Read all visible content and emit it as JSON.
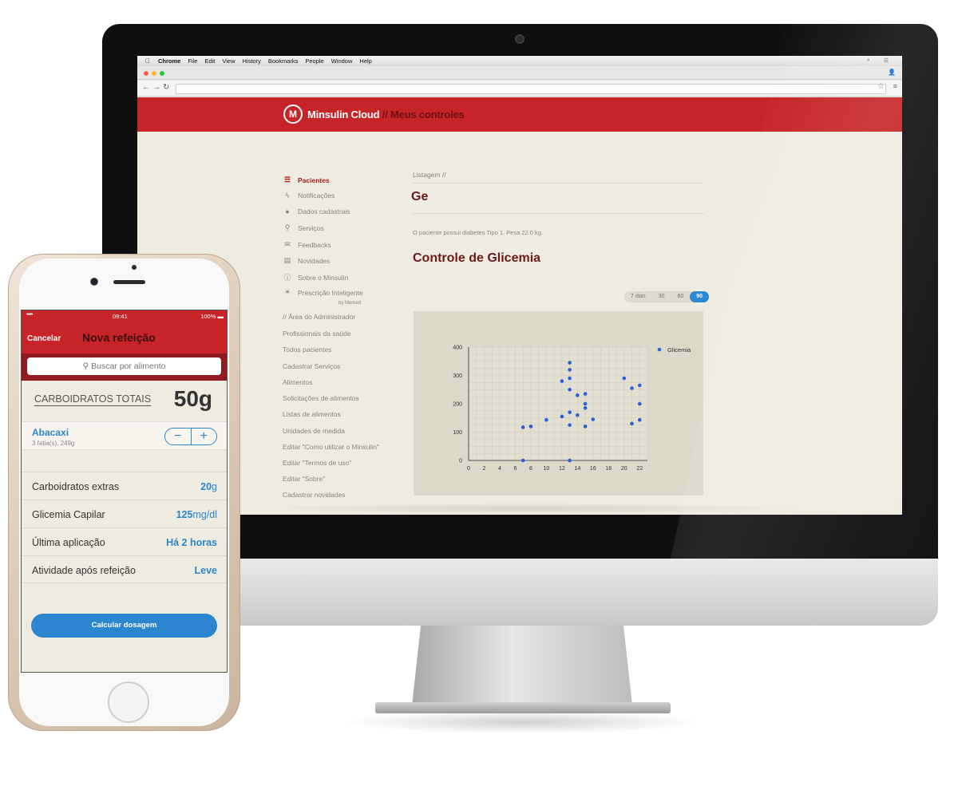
{
  "mac_menu": {
    "apple": "",
    "items": [
      "Chrome",
      "File",
      "Edit",
      "View",
      "History",
      "Bookmarks",
      "People",
      "Window",
      "Help"
    ]
  },
  "app": {
    "logo_letter": "M",
    "brand": "Minsulin Cloud",
    "separator": "//",
    "section": "Meus controles"
  },
  "sidebar": {
    "items": [
      {
        "label": "Pacientes",
        "icon": "list-icon"
      },
      {
        "label": "Notificações",
        "icon": "bolt-icon"
      },
      {
        "label": "Dados cadastrais",
        "icon": "user-icon"
      },
      {
        "label": "Serviços",
        "icon": "pin-icon"
      },
      {
        "label": "Feedbacks",
        "icon": "message-icon"
      },
      {
        "label": "Novidades",
        "icon": "news-icon"
      },
      {
        "label": "Sobre o Minsulin",
        "icon": "info-icon"
      },
      {
        "label": "Prescrição Inteligente",
        "icon": "bulb-icon"
      }
    ],
    "by_memed": "by Memed",
    "admin": [
      "// Área do Administrador",
      "Profissionais da saúde",
      "Todos pacientes",
      "Cadastrar Serviços",
      "Alimentos",
      "Solicitações de alimentos",
      "Listas de alimentos",
      "Unidades de medida",
      "Editar \"Como utilizar o Minsulin\"",
      "Editar \"Termos de uso\"",
      "Editar \"Sobre\"",
      "Cadastrar novidades"
    ]
  },
  "content": {
    "breadcrumb": "Listagem //",
    "patient_name": "Ge",
    "info": "O paciente possui diabetes Tipo 1. Pesa 22.0 kg.",
    "section_title": "Controle de Glicemia",
    "ranges": [
      "7 dias",
      "30",
      "60",
      "90"
    ],
    "active_range": "90"
  },
  "chart_data": {
    "type": "scatter",
    "series": [
      {
        "name": "Glicemia",
        "color": "#2b5fd8",
        "points": [
          [
            7,
            0
          ],
          [
            7,
            117
          ],
          [
            8,
            120
          ],
          [
            10,
            143
          ],
          [
            12,
            155
          ],
          [
            12,
            280
          ],
          [
            13,
            0
          ],
          [
            13,
            125
          ],
          [
            13,
            170
          ],
          [
            13,
            250
          ],
          [
            13,
            290
          ],
          [
            13,
            320
          ],
          [
            13,
            345
          ],
          [
            14,
            160
          ],
          [
            14,
            230
          ],
          [
            15,
            120
          ],
          [
            15,
            185
          ],
          [
            15,
            200
          ],
          [
            15,
            235
          ],
          [
            16,
            145
          ],
          [
            20,
            290
          ],
          [
            21,
            130
          ],
          [
            21,
            255
          ],
          [
            22,
            143
          ],
          [
            22,
            200
          ],
          [
            22,
            265
          ]
        ]
      }
    ],
    "xlim": [
      0,
      23
    ],
    "ylim": [
      0,
      400
    ],
    "xticks": [
      0,
      2,
      4,
      6,
      8,
      10,
      12,
      14,
      16,
      18,
      20,
      22
    ],
    "yticks": [
      0,
      100,
      200,
      300,
      400
    ],
    "legend": "top-right",
    "grid": true
  },
  "phone": {
    "status": {
      "carrier": "•••••",
      "time": "09:41",
      "battery": "100%"
    },
    "cancel": "Cancelar",
    "title": "Nova refeição",
    "search_placeholder": "Buscar por alimento",
    "carbs_label": "CARBOIDRATOS TOTAIS",
    "carbs_value": "50g",
    "food": {
      "name": "Abacaxi",
      "qty": "3 fatia(s), 249g",
      "minus": "−",
      "plus": "+"
    },
    "rows": [
      {
        "k": "Carboidratos extras",
        "v": "20",
        "u": "g"
      },
      {
        "k": "Glicemia Capilar",
        "v": "125",
        "u": "mg/dl"
      },
      {
        "k": "Última aplicação",
        "v": "Há 2 horas",
        "u": ""
      },
      {
        "k": "Atividade após refeição",
        "v": "Leve",
        "u": ""
      }
    ],
    "calc_button": "Calcular dosagem"
  },
  "colors": {
    "brand_red": "#c62428",
    "accent_blue": "#2b86cf",
    "dark_red_text": "#6a1a1a"
  }
}
